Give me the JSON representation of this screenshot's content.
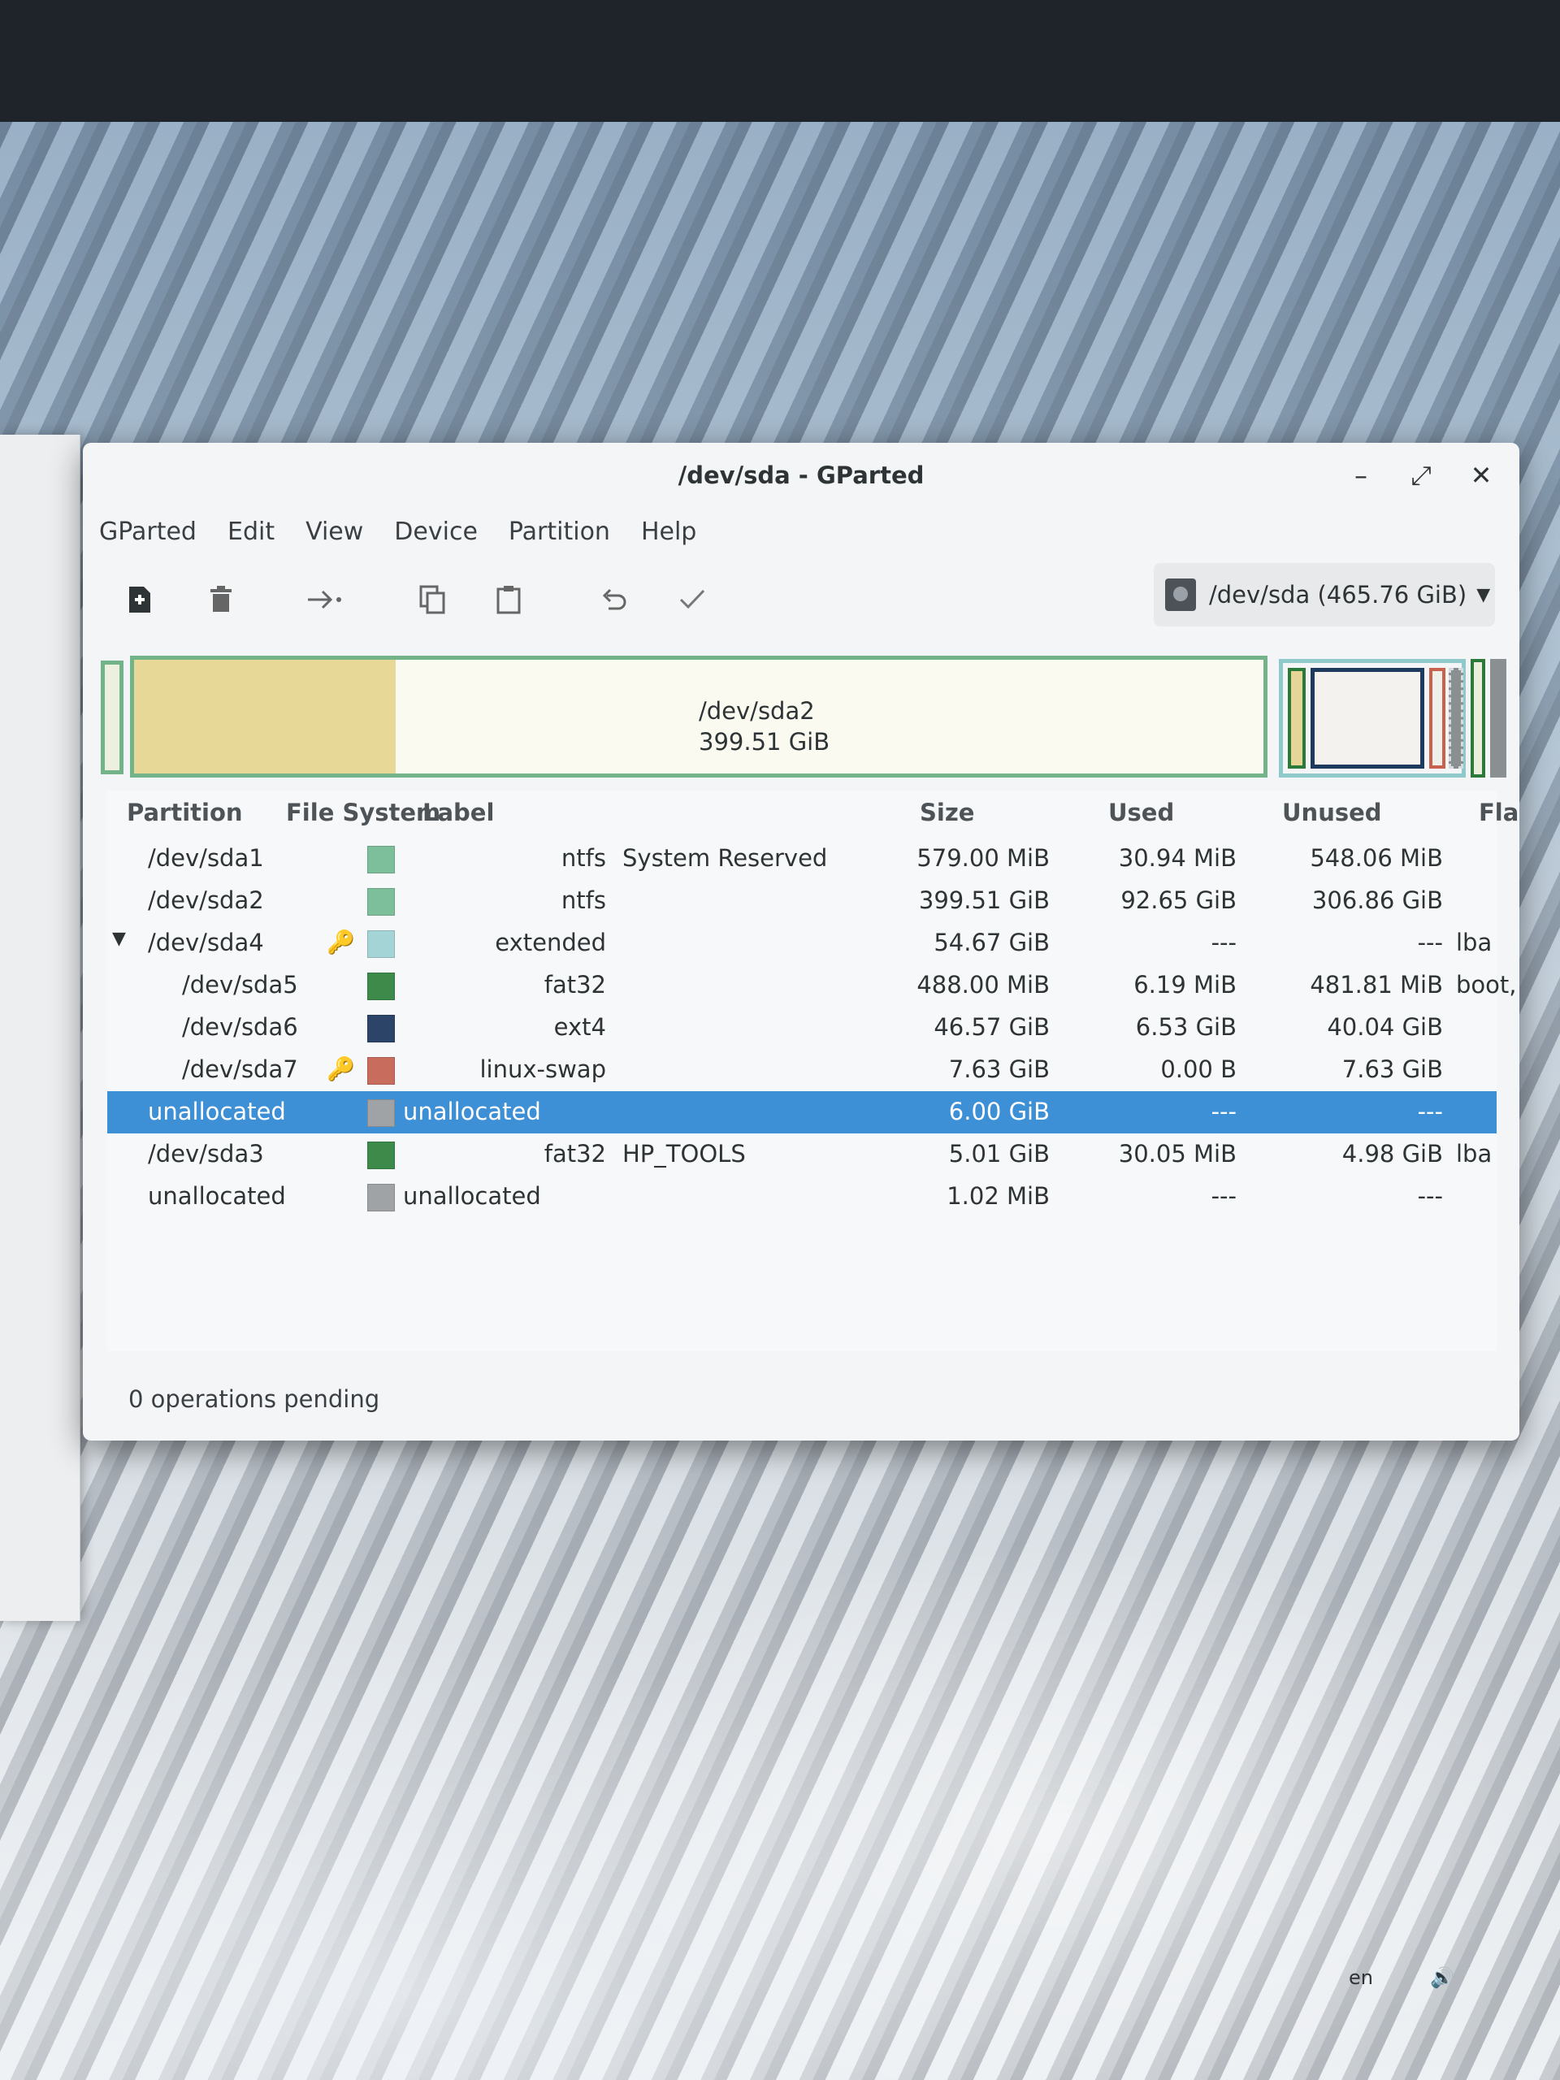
{
  "window": {
    "title": "/dev/sda - GParted",
    "minimize_glyph": "–",
    "maximize_glyph": "⤢",
    "close_glyph": "✕"
  },
  "menu": [
    "GParted",
    "Edit",
    "View",
    "Device",
    "Partition",
    "Help"
  ],
  "toolbar": {
    "icons": [
      "new-partition-icon",
      "delete-icon",
      "resize-move-icon",
      "copy-icon",
      "paste-icon",
      "undo-icon",
      "apply-icon"
    ],
    "device_selector": "/dev/sda (465.76 GiB)"
  },
  "disk_map": {
    "selected_label": "/dev/sda2",
    "selected_size": "399.51 GiB",
    "sda2_used_fraction": 0.232
  },
  "table": {
    "headers": [
      "Partition",
      "File System",
      "Label",
      "Size",
      "Used",
      "Unused",
      "Flags"
    ],
    "rows": [
      {
        "partition": "/dev/sda1",
        "fs": "ntfs",
        "label": "System Reserved",
        "size": "579.00 MiB",
        "used": "30.94 MiB",
        "unused": "548.06 MiB",
        "flags": "",
        "color": "#7ebf9b"
      },
      {
        "partition": "/dev/sda2",
        "fs": "ntfs",
        "label": "",
        "size": "399.51 GiB",
        "used": "92.65 GiB",
        "unused": "306.86 GiB",
        "flags": "",
        "color": "#7ebf9b"
      },
      {
        "partition": "/dev/sda4",
        "fs": "extended",
        "label": "",
        "size": "54.67 GiB",
        "used": "---",
        "unused": "---",
        "flags": "lba",
        "color": "#a4d4d6"
      },
      {
        "partition": "/dev/sda5",
        "fs": "fat32",
        "label": "",
        "size": "488.00 MiB",
        "used": "6.19 MiB",
        "unused": "481.81 MiB",
        "flags": "boot, esp",
        "color": "#3d8a4a"
      },
      {
        "partition": "/dev/sda6",
        "fs": "ext4",
        "label": "",
        "size": "46.57 GiB",
        "used": "6.53 GiB",
        "unused": "40.04 GiB",
        "flags": "",
        "color": "#2c4468"
      },
      {
        "partition": "/dev/sda7",
        "fs": "linux-swap",
        "label": "",
        "size": "7.63 GiB",
        "used": "0.00 B",
        "unused": "7.63 GiB",
        "flags": "",
        "color": "#c86c5e"
      },
      {
        "partition": "unallocated",
        "fs": "unallocated",
        "label": "",
        "size": "6.00 GiB",
        "used": "---",
        "unused": "---",
        "flags": "",
        "color": "#a0a3a6"
      },
      {
        "partition": "/dev/sda3",
        "fs": "fat32",
        "label": "HP_TOOLS",
        "size": "5.01 GiB",
        "used": "30.05 MiB",
        "unused": "4.98 GiB",
        "flags": "lba",
        "color": "#3d8a4a"
      },
      {
        "partition": "unallocated",
        "fs": "unallocated",
        "label": "",
        "size": "1.02 MiB",
        "used": "---",
        "unused": "---",
        "flags": "",
        "color": "#a0a3a6"
      }
    ]
  },
  "status": "0 operations pending",
  "tray": {
    "keyboard_layout": "en",
    "volume_icon": "🔊"
  }
}
